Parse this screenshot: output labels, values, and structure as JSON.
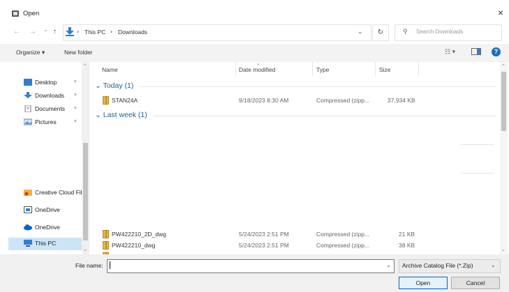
{
  "window": {
    "title": "Open",
    "close_glyph": "×"
  },
  "nav_buttons": {
    "back": "←",
    "forward": "→",
    "recent": "⌄",
    "up": "↑"
  },
  "address": {
    "crumbs": [
      "This PC",
      "Downloads"
    ],
    "separator": "›"
  },
  "search": {
    "placeholder": "Search Downloads"
  },
  "toolbar": {
    "organize": "Organize ▾",
    "new_folder": "New folder",
    "help": "?"
  },
  "sidebar": {
    "items": [
      {
        "label": "Desktop",
        "icon": "desktop-icon"
      },
      {
        "label": "Downloads",
        "icon": "download-icon"
      },
      {
        "label": "Documents",
        "icon": "documents-icon"
      },
      {
        "label": "Pictures",
        "icon": "pictures-icon"
      },
      {
        "label": "Creative Cloud Fil",
        "icon": "creative-cloud-icon"
      },
      {
        "label": "OneDrive",
        "icon": "onedrive-icon"
      },
      {
        "label": "OneDrive",
        "icon": "cloud-icon"
      },
      {
        "label": "This PC",
        "icon": "computer-icon"
      }
    ],
    "pin_glyph": "✶"
  },
  "columns": {
    "name": "Name",
    "date": "Date modified",
    "type": "Type",
    "size": "Size"
  },
  "groups": {
    "today": "Today (1)",
    "last_week": "Last week (1)"
  },
  "files_today": [
    {
      "name": "STAN24A",
      "date": "9/18/2023 8:30 AM",
      "type": "Compressed (zipp...",
      "size": "37,934 KB"
    }
  ],
  "files_bottom": [
    {
      "name": "PW422210_2D_dwg",
      "date": "5/24/2023 2:51 PM",
      "type": "Compressed (zipp...",
      "size": "21 KB"
    },
    {
      "name": "PW422210_dwg",
      "date": "5/24/2023 2:51 PM",
      "type": "Compressed (zipp...",
      "size": "38 KB"
    }
  ],
  "bottom": {
    "file_name_label": "File name:",
    "file_name_value": "",
    "filter": "Archive Catalog File (*.Zip)",
    "open": "Open",
    "cancel": "Cancel"
  },
  "colors": {
    "accent": "#1a6ebd",
    "group": "#1f5f98",
    "selection": "#cce4f7"
  }
}
